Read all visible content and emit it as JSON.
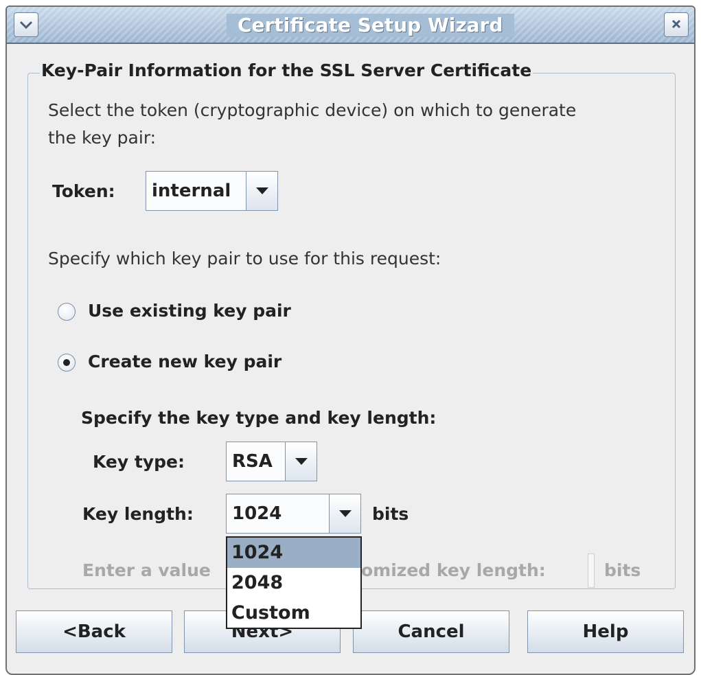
{
  "window": {
    "title": "Certificate Setup Wizard",
    "menu_icon": "chevron-down-icon",
    "close_icon": "close-icon"
  },
  "group": {
    "legend": "Key-Pair Information for the SSL Server Certificate",
    "token_instruction_line1": "Select the token (cryptographic device) on which to generate",
    "token_instruction_line2": "the key pair:",
    "token_label": "Token:",
    "token_value": "internal",
    "keypair_instruction": "Specify which key pair to use for this request:",
    "options": [
      {
        "label": "Use existing key pair",
        "selected": false
      },
      {
        "label": "Create new key pair",
        "selected": true
      }
    ],
    "keytype_heading": "Specify the key type and key length:",
    "key_type_label": "Key type:",
    "key_type_value": "RSA",
    "key_length_label": "Key length:",
    "key_length_value": "1024",
    "key_length_unit": "bits",
    "custom_prompt_left": "Enter a value",
    "custom_prompt_right": "omized key length:",
    "custom_unit": "bits"
  },
  "dropdown": {
    "items": [
      "1024",
      "2048",
      "Custom"
    ],
    "selected": "1024"
  },
  "buttons": {
    "back": "<Back",
    "next": "Next>",
    "cancel": "Cancel",
    "help": "Help"
  },
  "colors": {
    "titlebar": "#9cb5d1",
    "selection": "#9aaec6",
    "background": "#eeeeee"
  }
}
